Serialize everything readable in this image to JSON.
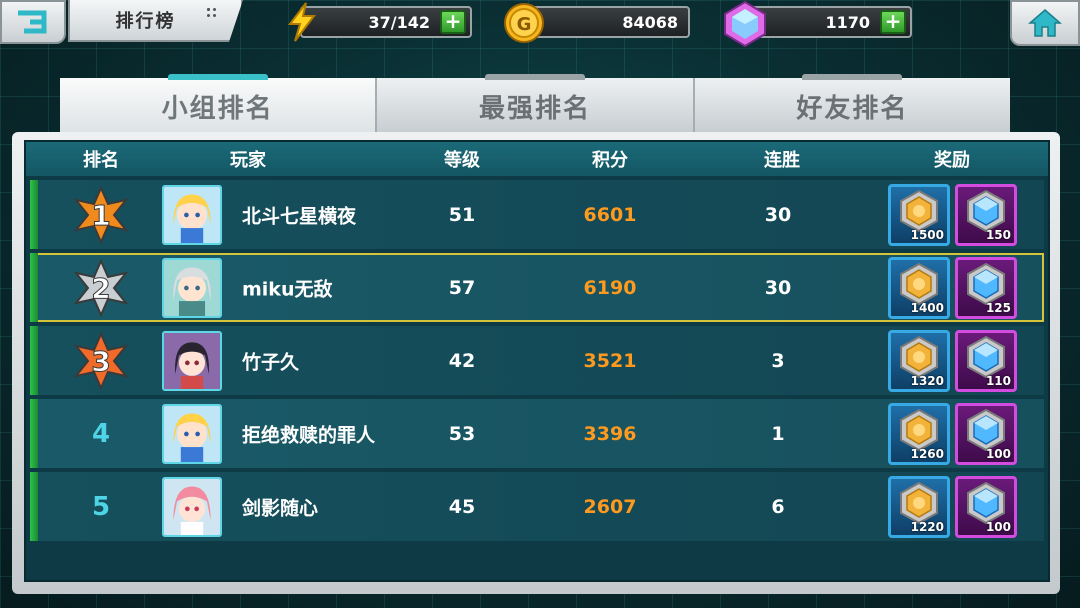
{
  "top_bar": {
    "title": "排行榜",
    "stamina": "37/142",
    "gold": "84068",
    "gems": "1170",
    "plus_label": "+"
  },
  "tabs": [
    {
      "label": "小组排名",
      "active": true
    },
    {
      "label": "最强排名",
      "active": false
    },
    {
      "label": "好友排名",
      "active": false
    }
  ],
  "table": {
    "headers": {
      "rank": "排名",
      "player": "玩家",
      "level": "等级",
      "score": "积分",
      "streak": "连胜",
      "reward": "奖励"
    },
    "rows": [
      {
        "rank": "1",
        "name": "北斗七星横夜",
        "level": "51",
        "score": "6601",
        "streak": "30",
        "reward_gold": "1500",
        "reward_gem": "150",
        "badge_color": "#f08a1c",
        "avatar": "blonde-girl-avatar"
      },
      {
        "rank": "2",
        "name": "miku无敌",
        "level": "57",
        "score": "6190",
        "streak": "30",
        "reward_gold": "1400",
        "reward_gem": "125",
        "badge_color": "#c8ced2",
        "avatar": "silver-hair-girl-avatar"
      },
      {
        "rank": "3",
        "name": "竹子久",
        "level": "42",
        "score": "3521",
        "streak": "3",
        "reward_gold": "1320",
        "reward_gem": "110",
        "badge_color": "#f06a2a",
        "avatar": "black-hair-girl-avatar"
      },
      {
        "rank": "4",
        "name": "拒绝救赎的罪人",
        "level": "53",
        "score": "3396",
        "streak": "1",
        "reward_gold": "1260",
        "reward_gem": "100",
        "badge_color": "",
        "avatar": "blonde-girl-avatar"
      },
      {
        "rank": "5",
        "name": "剑影随心",
        "level": "45",
        "score": "2607",
        "streak": "6",
        "reward_gold": "1220",
        "reward_gem": "100",
        "badge_color": "",
        "avatar": "pink-hair-girl-avatar"
      }
    ]
  },
  "colors": {
    "score": "#ff9a1e",
    "rank_number": "#4fd4e6",
    "highlight_border": "#d4c43a",
    "accent_bar": "#2ec34b"
  }
}
